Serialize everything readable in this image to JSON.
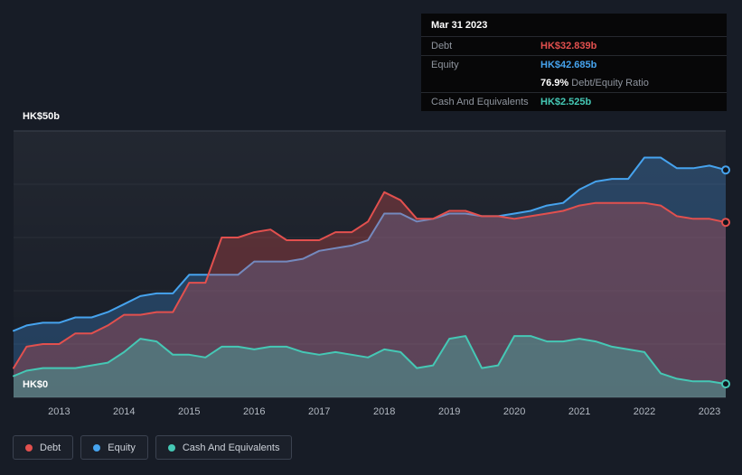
{
  "tooltip": {
    "date": "Mar 31 2023",
    "debt_label": "Debt",
    "debt_value": "HK$32.839b",
    "equity_label": "Equity",
    "equity_value": "HK$42.685b",
    "ratio_value": "76.9%",
    "ratio_label": "Debt/Equity Ratio",
    "cash_label": "Cash And Equivalents",
    "cash_value": "HK$2.525b"
  },
  "colors": {
    "background": "#171c26",
    "tooltip_background": "#070708",
    "gridline_major": "#3c4350",
    "gridline_minor": "rgba(255,255,255,0.06)",
    "axis_text": "#b3b9c2",
    "debt": "#e2504e",
    "equity": "#46a3ee",
    "cash": "#45c8b5"
  },
  "chart_data": {
    "type": "area",
    "x": [
      2012.3,
      2012.5,
      2012.75,
      2013.0,
      2013.25,
      2013.5,
      2013.75,
      2014.0,
      2014.25,
      2014.5,
      2014.75,
      2015.0,
      2015.25,
      2015.5,
      2015.75,
      2016.0,
      2016.25,
      2016.5,
      2016.75,
      2017.0,
      2017.25,
      2017.5,
      2017.75,
      2018.0,
      2018.25,
      2018.5,
      2018.75,
      2019.0,
      2019.25,
      2019.5,
      2019.75,
      2020.0,
      2020.25,
      2020.5,
      2020.75,
      2021.0,
      2021.25,
      2021.5,
      2021.75,
      2022.0,
      2022.25,
      2022.5,
      2022.75,
      2023.0,
      2023.25
    ],
    "series": [
      {
        "name": "Debt",
        "color": "#e2504e",
        "fill": "rgba(226,80,78,0.30)",
        "values": [
          5.5,
          9.5,
          10,
          10,
          12,
          12,
          13.5,
          15.5,
          15.5,
          16,
          16,
          21.5,
          21.5,
          30,
          30,
          31,
          31.5,
          29.5,
          29.5,
          29.5,
          31,
          31,
          33,
          38.5,
          37,
          33.5,
          33.5,
          35,
          35,
          34,
          34,
          33.5,
          34,
          34.5,
          35,
          36,
          36.5,
          36.5,
          36.5,
          36.5,
          36,
          34,
          33.5,
          33.5,
          32.839
        ]
      },
      {
        "name": "Equity",
        "color": "#46a3ee",
        "fill": "rgba(62,143,219,0.30)",
        "values": [
          12.5,
          13.5,
          14,
          14,
          15,
          15,
          16,
          17.5,
          19,
          19.5,
          19.5,
          23,
          23,
          23,
          23,
          25.5,
          25.5,
          25.5,
          26,
          27.5,
          28,
          28.5,
          29.5,
          34.5,
          34.5,
          33,
          33.5,
          34.5,
          34.5,
          34,
          34,
          34.5,
          35,
          36,
          36.5,
          39,
          40.5,
          41,
          41,
          45,
          45,
          43,
          43,
          43.5,
          42.685
        ]
      },
      {
        "name": "Cash And Equivalents",
        "color": "#45c8b5",
        "fill": "rgba(69,200,181,0.35)",
        "values": [
          4,
          5,
          5.5,
          5.5,
          5.5,
          6,
          6.5,
          8.5,
          11,
          10.5,
          8,
          8,
          7.5,
          9.5,
          9.5,
          9,
          9.5,
          9.5,
          8.5,
          8,
          8.5,
          8,
          7.5,
          9,
          8.5,
          5.5,
          6,
          11,
          11.5,
          5.5,
          6,
          11.5,
          11.5,
          10.5,
          10.5,
          11,
          10.5,
          9.5,
          9,
          8.5,
          4.5,
          3.5,
          3,
          3,
          2.525
        ]
      }
    ],
    "xlim": [
      2012.3,
      2023.25
    ],
    "ylim": [
      0,
      50
    ],
    "x_tick_values": [
      2013,
      2014,
      2015,
      2016,
      2017,
      2018,
      2019,
      2020,
      2021,
      2022,
      2023
    ],
    "x_tick_labels": [
      "2013",
      "2014",
      "2015",
      "2016",
      "2017",
      "2018",
      "2019",
      "2020",
      "2021",
      "2022",
      "2023"
    ],
    "y_gridlines": [
      0,
      10,
      20,
      30,
      40,
      50
    ],
    "y_tick_labels": {
      "top": "HK$50b",
      "bottom": "HK$0"
    },
    "legend_position": "bottom-left"
  }
}
